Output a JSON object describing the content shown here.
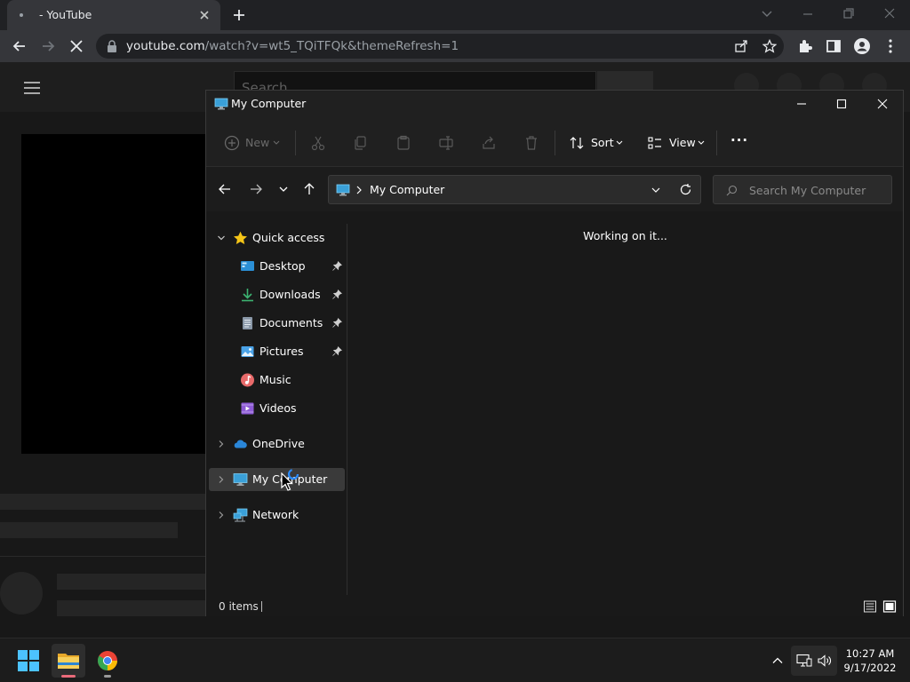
{
  "browser": {
    "tab_title": "- YouTube",
    "url_host": "youtube.com",
    "url_rest": "/watch?v=wt5_TQiTFQk&themeRefresh=1"
  },
  "youtube": {
    "search_placeholder": "Search"
  },
  "explorer": {
    "window_title": "My Computer",
    "toolbar": {
      "new_label": "New",
      "sort_label": "Sort",
      "view_label": "View",
      "more_label": "···"
    },
    "address": {
      "path": "My Computer"
    },
    "search": {
      "placeholder": "Search My Computer"
    },
    "sidebar": {
      "quick_access": "Quick access",
      "items": [
        {
          "label": "Desktop",
          "pinned": true
        },
        {
          "label": "Downloads",
          "pinned": true
        },
        {
          "label": "Documents",
          "pinned": true
        },
        {
          "label": "Pictures",
          "pinned": true
        },
        {
          "label": "Music",
          "pinned": false
        },
        {
          "label": "Videos",
          "pinned": false
        }
      ],
      "onedrive": "OneDrive",
      "my_computer": "My Computer",
      "network": "Network"
    },
    "content": {
      "message": "Working on it..."
    },
    "status": {
      "item_count": "0 items"
    }
  },
  "taskbar": {
    "time": "10:27 AM",
    "date": "9/17/2022"
  },
  "colors": {
    "accent": "#0078d4",
    "folder": "#f0c14b",
    "chrome_red": "#ea4335"
  }
}
